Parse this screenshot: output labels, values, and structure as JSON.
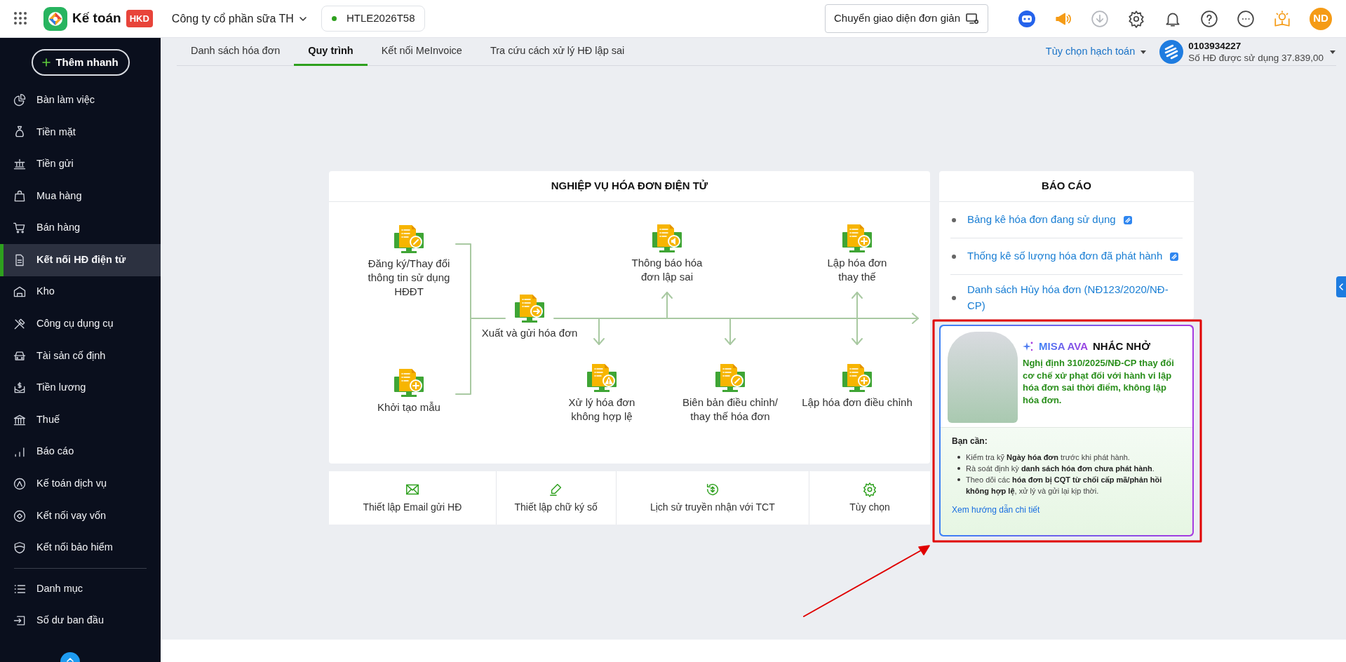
{
  "topbar": {
    "app_name": "Kế toán",
    "edition_badge": "HKD",
    "company": "Công ty cổ phần sữa TH",
    "db_code": "HTLE2026T58",
    "switch_button": "Chuyển giao diện đơn giản",
    "avatar": "ND"
  },
  "sidebar": {
    "quick_add": "Thêm nhanh",
    "items": [
      {
        "label": "Bàn làm việc",
        "selected": false
      },
      {
        "label": "Tiền mặt",
        "selected": false
      },
      {
        "label": "Tiền gửi",
        "selected": false
      },
      {
        "label": "Mua hàng",
        "selected": false
      },
      {
        "label": "Bán hàng",
        "selected": false
      },
      {
        "label": "Kết nối HĐ điện tử",
        "selected": true
      },
      {
        "label": "Kho",
        "selected": false
      },
      {
        "label": "Công cụ dụng cụ",
        "selected": false
      },
      {
        "label": "Tài sản cố định",
        "selected": false
      },
      {
        "label": "Tiền lương",
        "selected": false
      },
      {
        "label": "Thuế",
        "selected": false
      },
      {
        "label": "Báo cáo",
        "selected": false
      },
      {
        "label": "Kế toán dịch vụ",
        "selected": false
      },
      {
        "label": "Kết nối vay vốn",
        "selected": false
      },
      {
        "label": "Kết nối bảo hiểm",
        "selected": false
      }
    ],
    "bottom_items": [
      {
        "label": "Danh mục",
        "selected": false
      },
      {
        "label": "Số dư ban đầu",
        "selected": false
      }
    ]
  },
  "tabs": [
    {
      "label": "Danh sách hóa đơn",
      "selected": false
    },
    {
      "label": "Quy trình",
      "selected": true
    },
    {
      "label": "Kết nối MeInvoice",
      "selected": false
    },
    {
      "label": "Tra cứu cách xử lý HĐ lập sai",
      "selected": false
    }
  ],
  "account": {
    "option_link": "Tùy chọn hạch toán",
    "tax_code": "0103934227",
    "usage": "Số HĐ được sử dụng 37.839,00"
  },
  "process_card": {
    "title": "NGHIỆP VỤ HÓA ĐƠN ĐIỆN TỬ",
    "steps": [
      {
        "label": "Đăng ký/Thay đổi thông tin sử dụng HĐĐT",
        "kind": "edit"
      },
      {
        "label": "Khởi tạo mẫu",
        "kind": "add"
      },
      {
        "label": "Xuất và gửi hóa đơn",
        "kind": "send"
      },
      {
        "label": "Thông báo hóa đơn lập sai",
        "kind": "notify"
      },
      {
        "label": "Lập hóa đơn thay thế",
        "kind": "add"
      },
      {
        "label": "Xử lý hóa đơn không hợp lệ",
        "kind": "warning"
      },
      {
        "label": "Biên bản điều chỉnh/ thay thế hóa đơn",
        "kind": "edit"
      },
      {
        "label": "Lập hóa đơn điều chỉnh",
        "kind": "add"
      }
    ]
  },
  "shortcuts": [
    {
      "label": "Thiết lập Email gửi HĐ"
    },
    {
      "label": "Thiết lập chữ ký số"
    },
    {
      "label": "Lịch sử truyền nhận với TCT"
    },
    {
      "label": "Tùy chọn"
    }
  ],
  "reports": {
    "title": "BÁO CÁO",
    "items": [
      {
        "label": "Bảng kê hóa đơn đang sử dụng",
        "new_icon": true
      },
      {
        "label": "Thống kê số lượng hóa đơn đã phát hành",
        "new_icon": true
      },
      {
        "label": "Danh sách Hủy hóa đơn (NĐ123/2020/NĐ-CP)",
        "new_icon": false
      }
    ]
  },
  "reminder": {
    "brand": "MISA AVA",
    "title": "NHẮC NHỞ",
    "headline": "Nghị định 310/2025/NĐ-CP thay đổi cơ chế xử phạt đối với hành vi lập hóa đơn sai thời điểm, không lập hóa đơn.",
    "intro": "Bạn cần:",
    "tips": [
      "Kiểm tra kỹ **Ngày hóa đơn** trước khi phát hành.",
      "Rà soát định kỳ **danh sách hóa đơn chưa phát hành**.",
      "Theo dõi các **hóa đơn bị CQT từ chối cấp mã/phản hồi không hợp lệ**, xử lý và gửi lại kịp thời."
    ],
    "link": "Xem hướng dẫn chi tiết"
  }
}
